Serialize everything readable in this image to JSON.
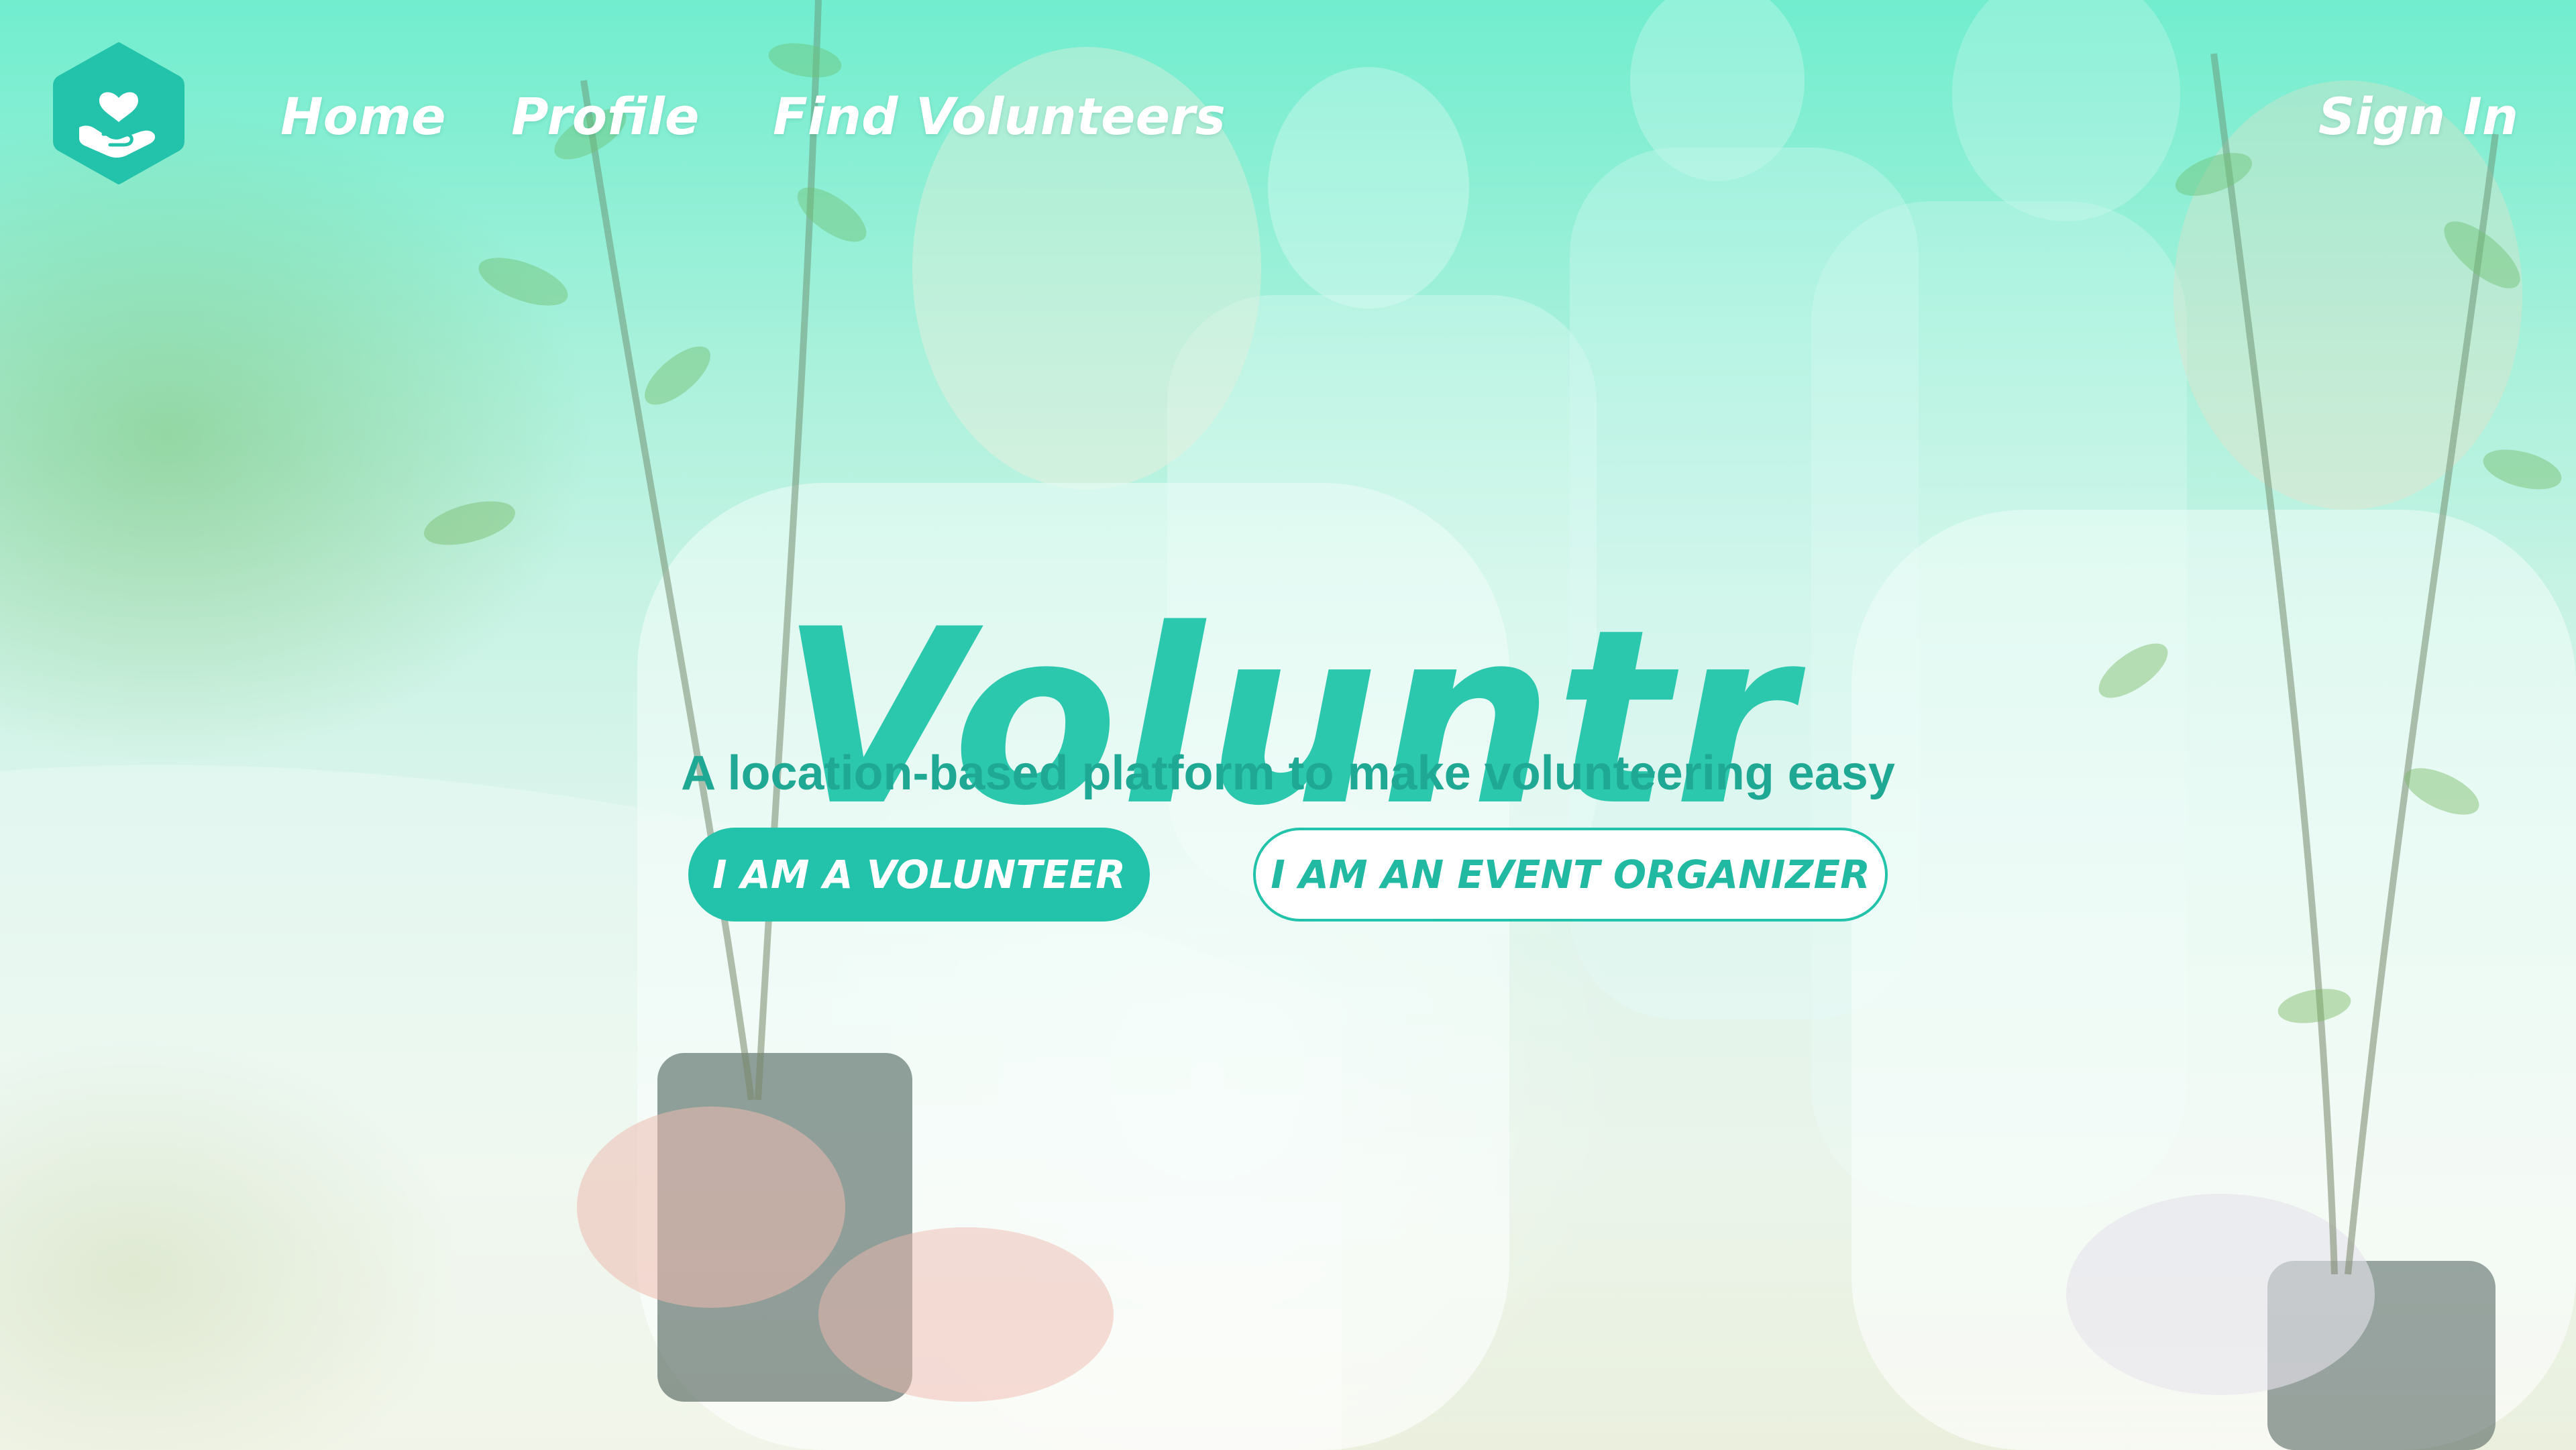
{
  "nav": {
    "logo_icon": "heart-in-hand-icon",
    "items": [
      {
        "label": "Home"
      },
      {
        "label": "Profile"
      },
      {
        "label": "Find Volunteers"
      }
    ],
    "sign_in_label": "Sign In"
  },
  "hero": {
    "brand": "Voluntr",
    "tagline": "A location-based platform to make volunteering easy",
    "volunteer_button_label": "I AM A VOLUNTEER",
    "organizer_button_label": "I AM AN EVENT ORGANIZER"
  },
  "colors": {
    "accent": "#22c3aa",
    "brand_text": "#2bc8ae",
    "tagline_text": "#1fa893",
    "nav_text": "#ffffff"
  }
}
